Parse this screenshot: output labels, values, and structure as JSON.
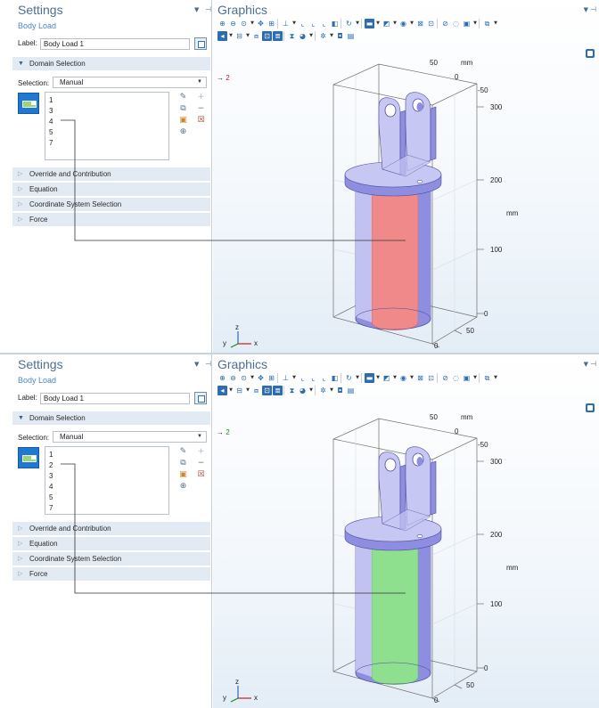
{
  "frames": [
    {
      "settings": {
        "title": "Settings",
        "subtitle": "Body Load",
        "label_caption": "Label:",
        "label_value": "Body Load 1",
        "domain_section": "Domain Selection",
        "selection_caption": "Selection:",
        "selection_value": "Manual",
        "domains": [
          "1",
          "3",
          "4",
          "5",
          "7"
        ],
        "collapsed_sections": [
          "Override and Contribution",
          "Equation",
          "Coordinate System Selection",
          "Force"
        ]
      },
      "graphics": {
        "title": "Graphics",
        "arrow_indicator_value": "2",
        "axis_ticks": {
          "top_50": "50",
          "top_mm": "mm",
          "top_0": "0",
          "top_neg50": "-50",
          "z_300": "300",
          "z_200": "200",
          "z_mm": "mm",
          "z_100": "100",
          "z_0": "0",
          "bottom_50": "50",
          "bottom_0": "0"
        },
        "triad": {
          "x": "x",
          "y": "y",
          "z": "z"
        },
        "highlight_color": "#f08a8a",
        "highlight_color_dark": "#d65e5e"
      }
    },
    {
      "settings": {
        "title": "Settings",
        "subtitle": "Body Load",
        "label_caption": "Label:",
        "label_value": "Body Load 1",
        "domain_section": "Domain Selection",
        "selection_caption": "Selection:",
        "selection_value": "Manual",
        "domains": [
          "1",
          "2",
          "3",
          "4",
          "5",
          "7"
        ],
        "collapsed_sections": [
          "Override and Contribution",
          "Equation",
          "Coordinate System Selection",
          "Force"
        ]
      },
      "graphics": {
        "title": "Graphics",
        "arrow_indicator_value": "2",
        "axis_ticks": {
          "top_50": "50",
          "top_mm": "mm",
          "top_0": "0",
          "top_neg50": "-50",
          "z_300": "300",
          "z_200": "200",
          "z_mm": "mm",
          "z_100": "100",
          "z_0": "0",
          "bottom_50": "50",
          "bottom_0": "0"
        },
        "triad": {
          "x": "x",
          "y": "y",
          "z": "z"
        },
        "highlight_color": "#8ee08e",
        "highlight_color_dark": "#5cc45c"
      }
    }
  ],
  "colors": {
    "body": "#c7c7f4",
    "body_dark": "#8e8ee0",
    "body_edge": "#4b4b9a",
    "accent": "#2d6cb0"
  }
}
